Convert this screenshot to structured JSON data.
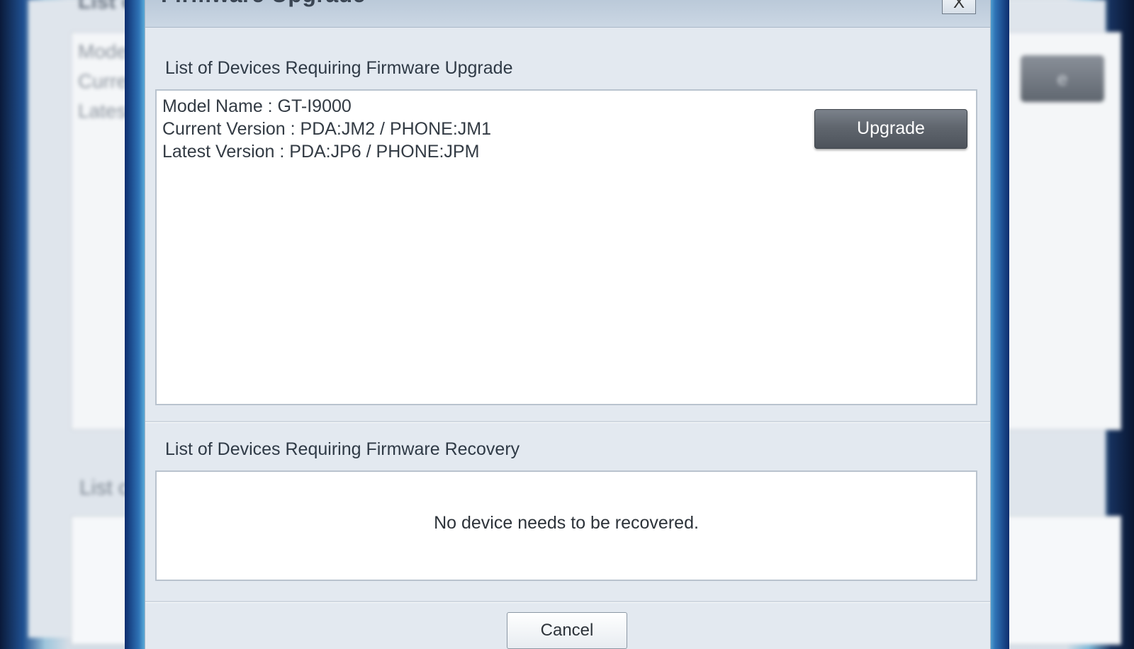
{
  "background": {
    "title": "List of",
    "lines": [
      "Model N",
      "Curren",
      "Latest V"
    ],
    "button": "e",
    "sub_title": "List of"
  },
  "dialog": {
    "title": "Firmware Upgrade",
    "close_label": "X",
    "upgrade_section": {
      "title": "List of Devices Requiring Firmware Upgrade",
      "device": {
        "model": "Model Name : GT-I9000",
        "current": "Current Version : PDA:JM2 / PHONE:JM1",
        "latest": "Latest Version : PDA:JP6 / PHONE:JPM"
      },
      "upgrade_label": "Upgrade"
    },
    "recovery_section": {
      "title": "List of Devices Requiring Firmware Recovery",
      "empty_message": "No device needs to be recovered."
    },
    "cancel_label": "Cancel"
  }
}
